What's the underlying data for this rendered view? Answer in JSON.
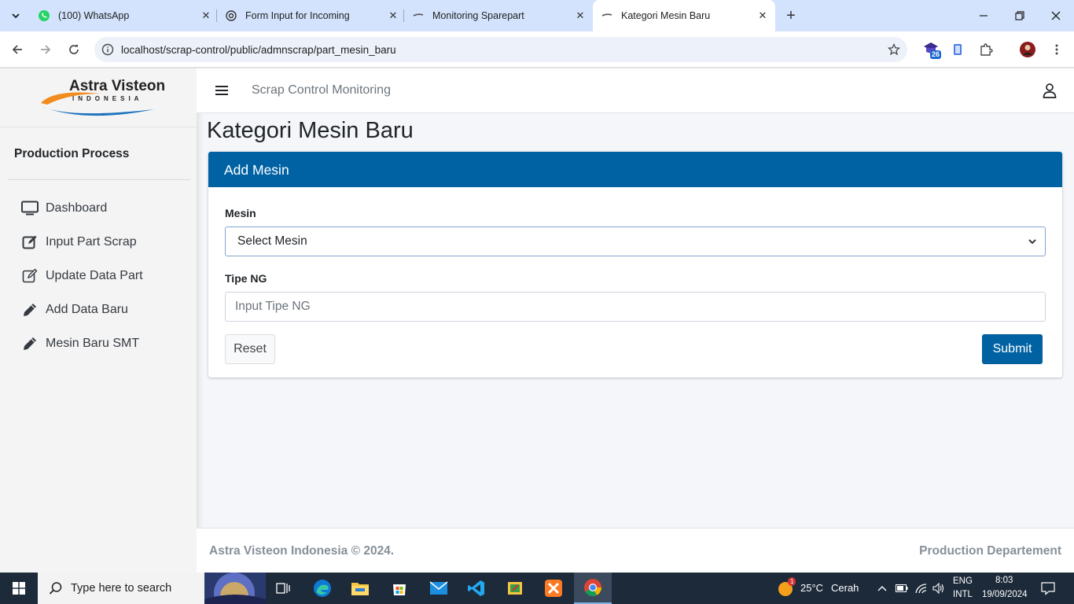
{
  "browser": {
    "tabs": [
      {
        "title": "(100) WhatsApp",
        "icon": "whatsapp-icon",
        "active": false
      },
      {
        "title": "Form Input for Incoming",
        "icon": "openai-icon",
        "active": false
      },
      {
        "title": "Monitoring Sparepart",
        "icon": "page-icon",
        "active": false
      },
      {
        "title": "Kategori Mesin Baru",
        "icon": "page-icon",
        "active": true
      }
    ],
    "url": "localhost/scrap-control/public/admnscrap/part_mesin_baru",
    "extension_badge": "26"
  },
  "sidebar": {
    "logo_line1": "Astra Visteon",
    "logo_line2": "INDONESIA",
    "heading": "Production Process",
    "items": [
      {
        "label": "Dashboard",
        "icon": "monitor-icon"
      },
      {
        "label": "Input Part Scrap",
        "icon": "edit-square-icon"
      },
      {
        "label": "Update Data Part",
        "icon": "edit-outline-icon"
      },
      {
        "label": "Add Data Baru",
        "icon": "pencil-icon"
      },
      {
        "label": "Mesin Baru SMT",
        "icon": "pencil-icon"
      }
    ]
  },
  "topnav": {
    "title": "Scrap Control Monitoring"
  },
  "page": {
    "title": "Kategori Mesin Baru"
  },
  "card": {
    "header": "Add Mesin",
    "mesin_label": "Mesin",
    "mesin_selected": "Select Mesin",
    "tipe_label": "Tipe NG",
    "tipe_placeholder": "Input Tipe NG",
    "reset_label": "Reset",
    "submit_label": "Submit"
  },
  "footer": {
    "left": "Astra Visteon Indonesia © 2024.",
    "right": "Production Departement"
  },
  "taskbar": {
    "search_placeholder": "Type here to search",
    "weather_temp": "25°C",
    "weather_text": "Cerah",
    "weather_badge": "1",
    "lang_line1": "ENG",
    "lang_line2": "INTL",
    "time": "8:03",
    "date": "19/09/2024"
  }
}
